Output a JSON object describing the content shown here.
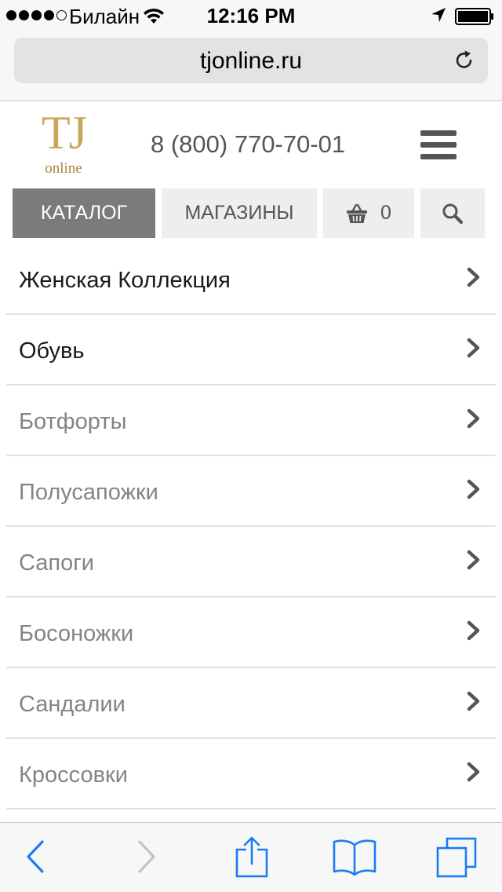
{
  "status_bar": {
    "carrier": "Билайн",
    "time": "12:16 PM",
    "signal_strength": "4 of 5",
    "icons": [
      "wifi-icon",
      "location-arrow-icon",
      "battery-icon"
    ]
  },
  "browser": {
    "url": "tjonline.ru",
    "reload_icon": "reload-icon"
  },
  "header": {
    "logo_main": "TJ",
    "logo_sub": "online",
    "phone": "8 (800) 770-70-01",
    "menu_icon": "hamburger-menu-icon"
  },
  "nav": {
    "catalog": "КАТАЛОГ",
    "shops": "МАГАЗИНЫ",
    "cart_count": "0",
    "cart_icon": "basket-icon",
    "search_icon": "search-icon"
  },
  "categories": [
    {
      "label": "Женская Коллекция",
      "level": "primary"
    },
    {
      "label": "Обувь",
      "level": "primary"
    },
    {
      "label": "Ботфорты",
      "level": "secondary"
    },
    {
      "label": "Полусапожки",
      "level": "secondary"
    },
    {
      "label": "Сапоги",
      "level": "secondary"
    },
    {
      "label": "Босоножки",
      "level": "secondary"
    },
    {
      "label": "Сандалии",
      "level": "secondary"
    },
    {
      "label": "Кроссовки",
      "level": "secondary"
    }
  ],
  "toolbar": {
    "icons": [
      "back-icon",
      "forward-icon",
      "share-icon",
      "bookmarks-icon",
      "tabs-icon"
    ]
  },
  "colors": {
    "accent_blue": "#1a7cf5",
    "logo_gold": "#c9a55a",
    "active_tab": "#7b7b7b",
    "tab_bg": "#eeeeee"
  }
}
